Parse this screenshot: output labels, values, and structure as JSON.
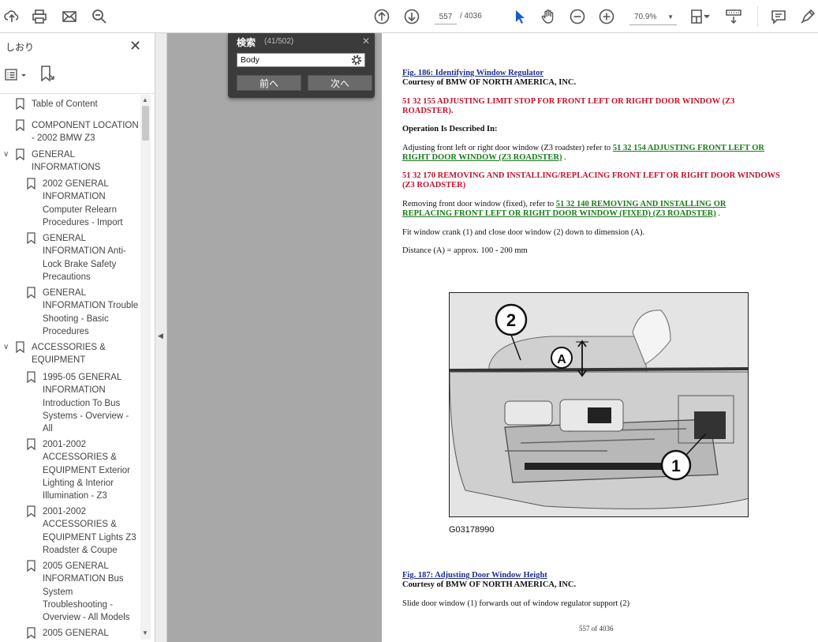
{
  "toolbar": {
    "icons": [
      "upload-icon",
      "print-icon",
      "mail-icon",
      "zoom-search-icon",
      "prev-page-icon",
      "next-page-icon",
      "select-cursor-icon",
      "hand-tool-icon",
      "zoom-out-icon",
      "zoom-in-icon",
      "page-fit-icon",
      "keyboard-scroll-icon",
      "comment-icon",
      "pen-icon"
    ],
    "page_current": "557",
    "page_total": "/ 4036",
    "zoom": "70.9%"
  },
  "sidebar": {
    "title": "しおり",
    "bookmarks": [
      {
        "label": "Table of Content",
        "expanded": null,
        "indent": 0
      },
      {
        "label": "COMPONENT LOCATION - 2002 BMW Z3",
        "expanded": null,
        "indent": 0
      },
      {
        "label": "GENERAL INFORMATIONS",
        "expanded": true,
        "indent": 0
      },
      {
        "label": "2002 GENERAL INFORMATION Computer Relearn Procedures - Import",
        "expanded": null,
        "indent": 1
      },
      {
        "label": "GENERAL INFORMATION Anti-Lock Brake Safety Precautions",
        "expanded": null,
        "indent": 1
      },
      {
        "label": "GENERAL INFORMATION Trouble Shooting - Basic Procedures",
        "expanded": null,
        "indent": 1
      },
      {
        "label": "ACCESSORIES & EQUIPMENT",
        "expanded": true,
        "indent": 0
      },
      {
        "label": "1995-05 GENERAL INFORMATION Introduction To Bus Systems - Overview - All",
        "expanded": null,
        "indent": 1
      },
      {
        "label": "2001-2002 ACCESSORIES & EQUIPMENT Exterior Lighting & Interior Illumination - Z3",
        "expanded": null,
        "indent": 1
      },
      {
        "label": "2001-2002 ACCESSORIES & EQUIPMENT Lights Z3 Roadster & Coupe",
        "expanded": null,
        "indent": 1
      },
      {
        "label": "2005 GENERAL INFORMATION Bus System Troubleshooting - Overview - All Models",
        "expanded": null,
        "indent": 1
      },
      {
        "label": "2005 GENERAL",
        "expanded": null,
        "indent": 1
      }
    ]
  },
  "search": {
    "title": "検索",
    "count": "(41/502)",
    "query": "Body",
    "prev_label": "前へ",
    "next_label": "次へ"
  },
  "document": {
    "fig186": "Fig. 186: Identifying Window Regulator",
    "courtesy1": "Courtesy of BMW OF NORTH AMERICA, INC.",
    "heading1": "51 32 155 ADJUSTING LIMIT STOP FOR FRONT LEFT OR RIGHT DOOR WINDOW (Z3 ROADSTER).",
    "op_described": "Operation Is Described In:",
    "adj_text": "Adjusting front left or right door window (Z3 roadster) refer to",
    "adj_link": "51 32 154 ADJUSTING FRONT LEFT OR RIGHT DOOR WINDOW (Z3 ROADSTER)",
    "heading2": "51 32 170 REMOVING AND INSTALLING/REPLACING FRONT LEFT OR RIGHT DOOR WINDOWS (Z3 ROADSTER)",
    "rem_text": "Removing front door window (fixed), refer to",
    "rem_link": "51 32 140 REMOVING AND INSTALLING OR REPLACING FRONT LEFT OR RIGHT DOOR WINDOW (FIXED) (Z3 ROADSTER)",
    "fit_text": "Fit window crank (1) and close door window (2) down to dimension (A).",
    "distance_text": "Distance (A) = approx. 100 - 200 mm",
    "figure_labels": {
      "one": "1",
      "two": "2",
      "a": "A"
    },
    "figure_code": "G03178990",
    "fig187": "Fig. 187: Adjusting Door Window Height",
    "courtesy2": "Courtesy of BMW OF NORTH AMERICA, INC.",
    "slide_text": "Slide door window (1) forwards out of window regulator support (2)",
    "footer": "557 of 4036"
  }
}
